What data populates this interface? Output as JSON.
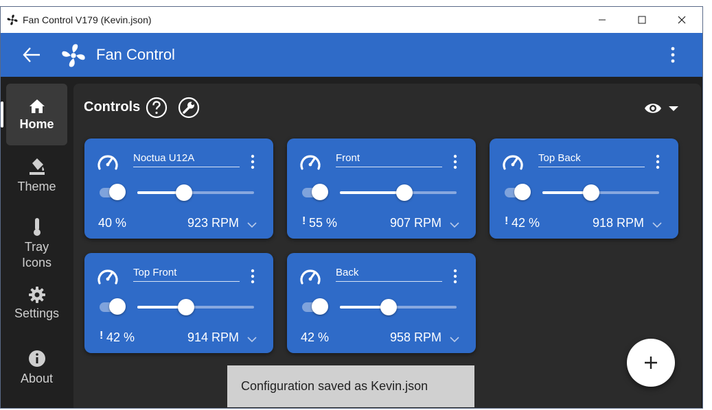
{
  "window": {
    "title": "Fan Control V179 (Kevin.json)"
  },
  "appbar": {
    "title": "Fan Control"
  },
  "sidebar": {
    "items": [
      {
        "label": "Home",
        "icon": "home-icon",
        "active": true
      },
      {
        "label": "Theme",
        "icon": "paint-bucket-icon"
      },
      {
        "label": "Tray\nIcons",
        "icon": "thermometer-icon"
      },
      {
        "label": "Settings",
        "icon": "gear-icon"
      },
      {
        "label": "About",
        "icon": "info-icon"
      }
    ]
  },
  "main": {
    "section_title": "Controls"
  },
  "controls": [
    {
      "name": "Noctua U12A",
      "percent": "40 %",
      "rpm": "923 RPM",
      "warning": false,
      "level": 0.4
    },
    {
      "name": "Front",
      "percent": "55 %",
      "rpm": "907 RPM",
      "warning": true,
      "level": 0.55
    },
    {
      "name": "Top Back",
      "percent": "42 %",
      "rpm": "918 RPM",
      "warning": true,
      "level": 0.42
    },
    {
      "name": "Top Front",
      "percent": "42 %",
      "rpm": "914 RPM",
      "warning": true,
      "level": 0.42
    },
    {
      "name": "Back",
      "percent": "42 %",
      "rpm": "958 RPM",
      "warning": false,
      "level": 0.42
    }
  ],
  "warning_mark": "!",
  "toast": {
    "message": "Configuration saved as Kevin.json"
  },
  "colors": {
    "accent": "#2f6bc8",
    "background": "#202020",
    "panel": "#2b2b2b"
  }
}
